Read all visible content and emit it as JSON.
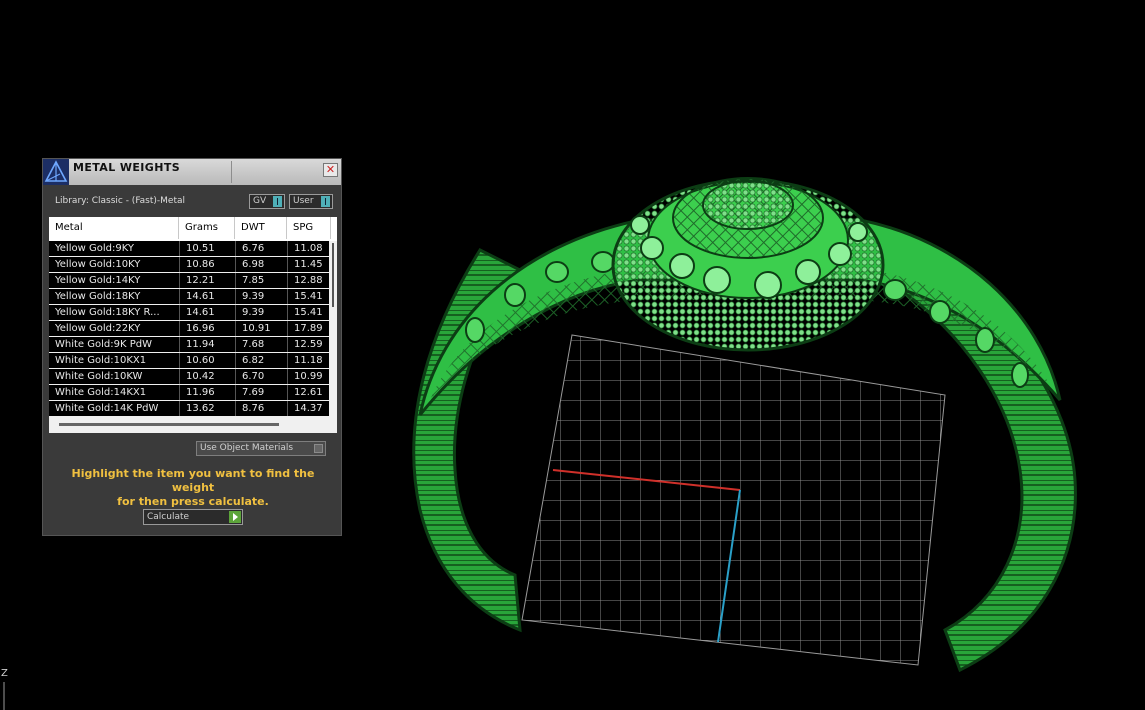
{
  "viewport": {
    "axis_label": "Z"
  },
  "panel": {
    "title": "METAL WEIGHTS",
    "close_icon": "close-icon",
    "logo_icon": "tetrahedron-logo-icon",
    "library_label": "Library: Classic - (Fast)-Metal",
    "gv_label": "GV",
    "user_label": "User",
    "columns": [
      "Metal",
      "Grams",
      "DWT",
      "SPG"
    ],
    "rows": [
      [
        "Yellow Gold:9KY",
        "10.51",
        "6.76",
        "11.08"
      ],
      [
        "Yellow Gold:10KY",
        "10.86",
        "6.98",
        "11.45"
      ],
      [
        "Yellow Gold:14KY",
        "12.21",
        "7.85",
        "12.88"
      ],
      [
        "Yellow Gold:18KY",
        "14.61",
        "9.39",
        "15.41"
      ],
      [
        "Yellow Gold:18KY R...",
        "14.61",
        "9.39",
        "15.41"
      ],
      [
        "Yellow Gold:22KY",
        "16.96",
        "10.91",
        "17.89"
      ],
      [
        "White Gold:9K PdW",
        "11.94",
        "7.68",
        "12.59"
      ],
      [
        "White Gold:10KX1",
        "10.60",
        "6.82",
        "11.18"
      ],
      [
        "White Gold:10KW",
        "10.42",
        "6.70",
        "10.99"
      ],
      [
        "White Gold:14KX1",
        "11.96",
        "7.69",
        "12.61"
      ],
      [
        "White Gold:14K PdW",
        "13.62",
        "8.76",
        "14.37"
      ]
    ],
    "use_object_materials_label": "Use Object Materials",
    "instruction_line1": "Highlight the item you want to find the weight",
    "instruction_line2": "for then press calculate.",
    "calculate_label": "Calculate"
  },
  "colors": {
    "model_green": "#3ccf4e",
    "grid_line": "#9a9a9a",
    "x_axis": "#d0302a",
    "y_axis": "#2aa0c8",
    "instruction_text": "#f0c040"
  }
}
